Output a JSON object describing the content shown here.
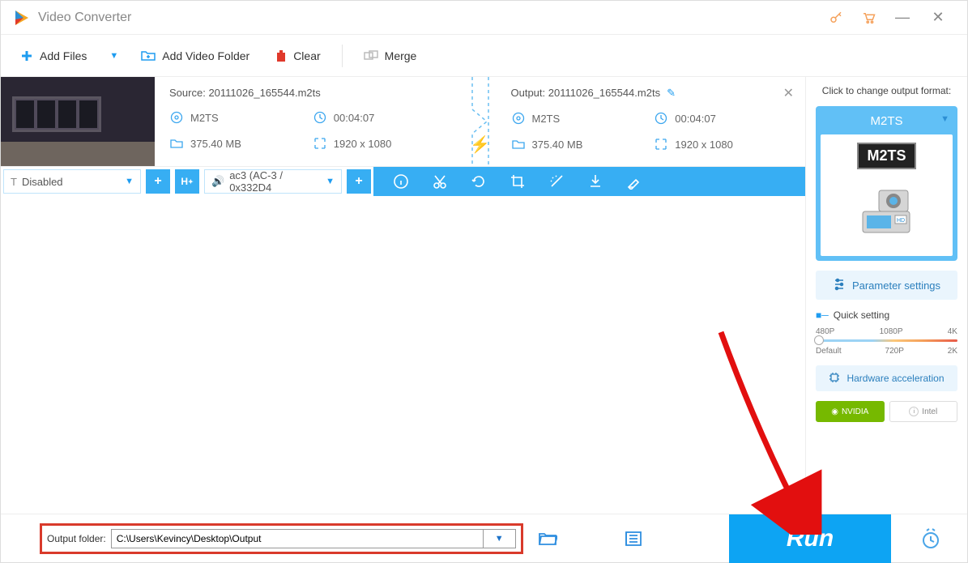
{
  "titlebar": {
    "title": "Video Converter"
  },
  "toolbar": {
    "add_files": "Add Files",
    "add_folder": "Add Video Folder",
    "clear": "Clear",
    "merge": "Merge"
  },
  "item": {
    "source_label": "Source:",
    "source_file": "20111026_165544.m2ts",
    "output_label": "Output:",
    "output_file": "20111026_165544.m2ts",
    "src": {
      "format": "M2TS",
      "duration": "00:04:07",
      "size": "375.40 MB",
      "resolution": "1920 x 1080"
    },
    "out": {
      "format": "M2TS",
      "duration": "00:04:07",
      "size": "375.40 MB",
      "resolution": "1920 x 1080"
    }
  },
  "controls": {
    "subtitle": "Disabled",
    "audio": "ac3 (AC-3 / 0x332D4"
  },
  "right": {
    "change_label": "Click to change output format:",
    "format_name": "M2TS",
    "format_badge": "M2TS",
    "param_btn": "Parameter settings",
    "quick_title": "Quick setting",
    "presets_top": [
      "480P",
      "1080P",
      "4K"
    ],
    "presets_bottom": [
      "Default",
      "720P",
      "2K"
    ],
    "hw_btn": "Hardware acceleration",
    "nvidia": "NVIDIA",
    "intel": "Intel"
  },
  "bottom": {
    "out_label": "Output folder:",
    "out_path": "C:\\Users\\Kevincy\\Desktop\\Output",
    "run": "Run"
  }
}
